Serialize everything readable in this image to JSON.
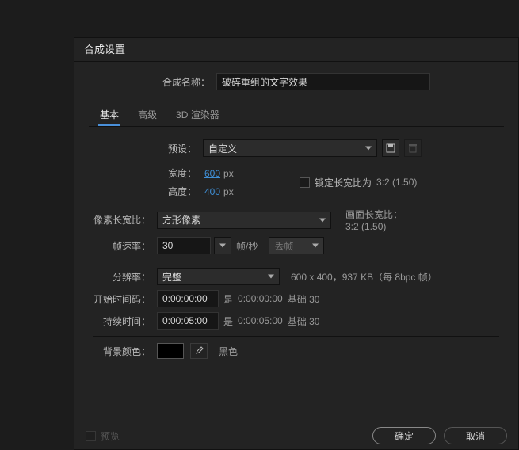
{
  "window": {
    "title": "合成设置"
  },
  "header": {
    "name_label": "合成名称：",
    "name_value": "破碎重组的文字效果"
  },
  "tabs": {
    "basic": "基本",
    "advanced": "高级",
    "renderer": "3D 渲染器"
  },
  "preset": {
    "label": "预设：",
    "value": "自定义"
  },
  "dims": {
    "width_label": "宽度：",
    "width_value": "600",
    "width_unit": "px",
    "height_label": "高度：",
    "height_value": "400",
    "height_unit": "px",
    "lock_label": "锁定长宽比为",
    "lock_ratio": "3:2 (1.50)"
  },
  "par": {
    "label": "像素长宽比：",
    "value": "方形像素",
    "frame_label": "画面长宽比：",
    "frame_value": "3:2 (1.50)"
  },
  "fps": {
    "label": "帧速率：",
    "value": "30",
    "unit": "帧/秒",
    "drop": "丢帧"
  },
  "res": {
    "label": "分辨率：",
    "value": "完整",
    "info": "600 x 400，937 KB（每 8bpc 帧）"
  },
  "start": {
    "label": "开始时间码：",
    "value": "0:00:00:00",
    "is": "是",
    "base": "0:00:00:00",
    "basis": "基础 30"
  },
  "dur": {
    "label": "持续时间：",
    "value": "0:00:05:00",
    "is": "是",
    "base": "0:00:05:00",
    "basis": "基础 30"
  },
  "bg": {
    "label": "背景颜色：",
    "name": "黑色"
  },
  "footer": {
    "preview": "预览",
    "ok": "确定",
    "cancel": "取消"
  }
}
